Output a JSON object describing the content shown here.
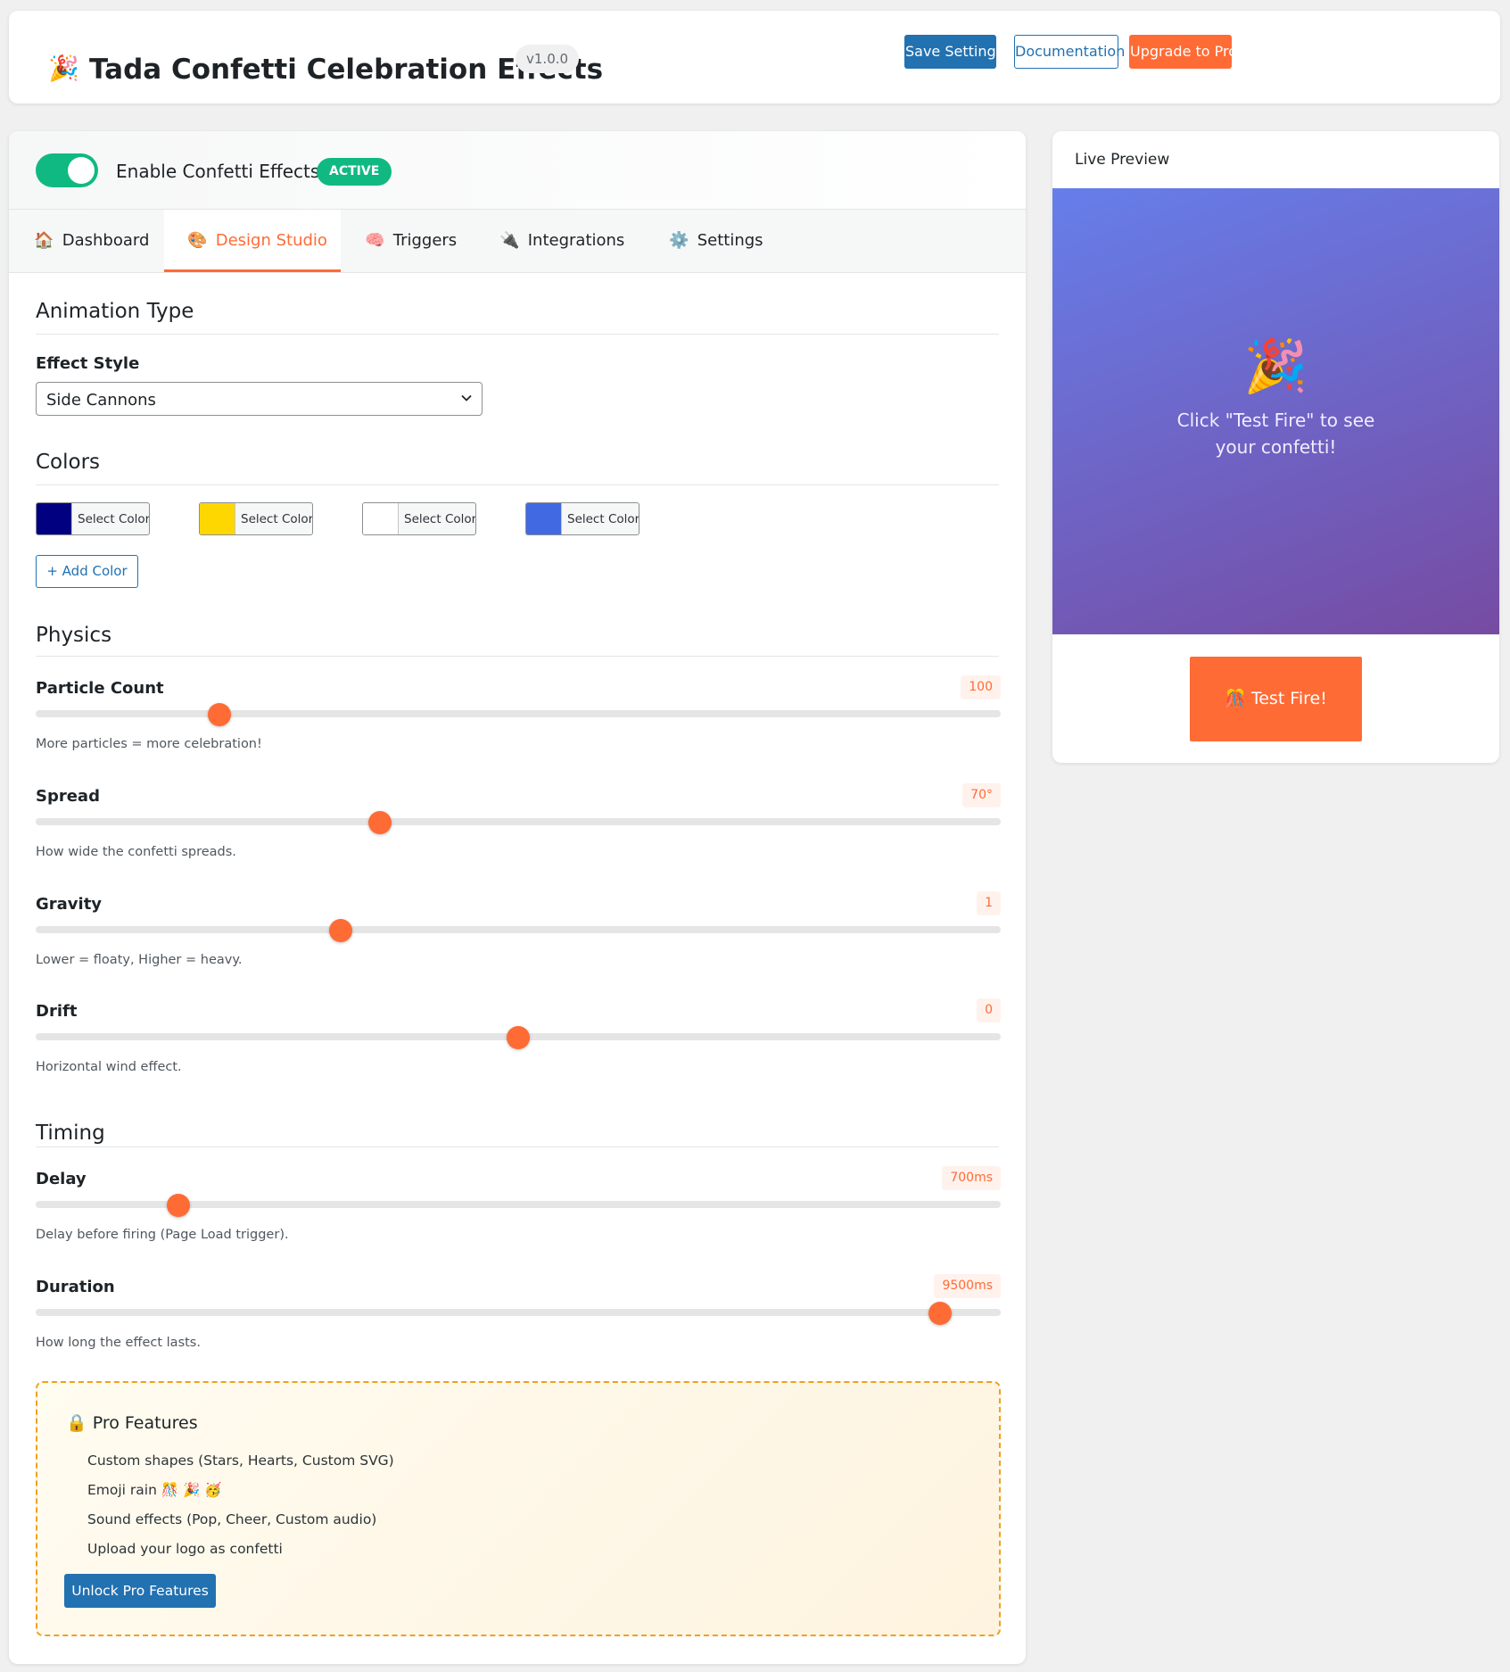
{
  "header": {
    "logo_icon": "party-popper-icon",
    "logo_glyph": "🎉",
    "title": "Tada Confetti Celebration Effects",
    "version": "v1.0.0",
    "save_label": "Save Settings",
    "docs_label": "Documentation",
    "upgrade_label": "Upgrade to Pro"
  },
  "enable": {
    "label": "Enable Confetti Effects",
    "status": "ACTIVE",
    "enabled": true
  },
  "tabs": [
    {
      "icon": "house-icon",
      "glyph": "🏠",
      "label": "Dashboard",
      "active": false
    },
    {
      "icon": "palette-icon",
      "glyph": "🎨",
      "label": "Design Studio",
      "active": true
    },
    {
      "icon": "brain-icon",
      "glyph": "🧠",
      "label": "Triggers",
      "active": false
    },
    {
      "icon": "plug-icon",
      "glyph": "🔌",
      "label": "Integrations",
      "active": false
    },
    {
      "icon": "gear-icon",
      "glyph": "⚙️",
      "label": "Settings",
      "active": false
    }
  ],
  "animation": {
    "section_title": "Animation Type",
    "effect_label": "Effect Style",
    "effect_value": "Side Cannons"
  },
  "colors": {
    "section_title": "Colors",
    "swatches": [
      {
        "color": "#000080",
        "label": "Select Color"
      },
      {
        "color": "#ffd700",
        "label": "Select Color"
      },
      {
        "color": "#ffffff",
        "label": "Select Color"
      },
      {
        "color": "#4169e1",
        "label": "Select Color"
      }
    ],
    "add_label": "+ Add Color"
  },
  "physics": {
    "section_title": "Physics",
    "sliders": [
      {
        "label": "Particle Count",
        "value": "100",
        "position": 0.19,
        "hint": "More particles = more celebration!"
      },
      {
        "label": "Spread",
        "value": "70°",
        "position": 0.357,
        "hint": "How wide the confetti spreads."
      },
      {
        "label": "Gravity",
        "value": "1",
        "position": 0.316,
        "hint": "Lower = floaty, Higher = heavy."
      },
      {
        "label": "Drift",
        "value": "0",
        "position": 0.5,
        "hint": "Horizontal wind effect."
      }
    ]
  },
  "timing": {
    "section_title": "Timing",
    "sliders": [
      {
        "label": "Delay",
        "value": "700ms",
        "position": 0.148,
        "hint": "Delay before firing (Page Load trigger)."
      },
      {
        "label": "Duration",
        "value": "9500ms",
        "position": 0.937,
        "hint": "How long the effect lasts."
      }
    ]
  },
  "pro": {
    "lock_icon": "lock-icon",
    "lock_glyph": "🔒",
    "title": "Pro Features",
    "items": [
      "Custom shapes (Stars, Hearts, Custom SVG)",
      "Emoji rain 🎊 🎉 🥳",
      "Sound effects (Pop, Cheer, Custom audio)",
      "Upload your logo as confetti"
    ],
    "button_label": "Unlock Pro Features"
  },
  "preview": {
    "title": "Live Preview",
    "stage_icon": "party-popper-icon",
    "stage_glyph": "🎉",
    "message": "Click \"Test Fire\" to see your confetti!",
    "button_icon": "confetti-ball-icon",
    "button_label": "🎊 Test Fire!"
  },
  "colors_theme": {
    "accent": "#ff6b35",
    "primary": "#2271b1",
    "active_green": "#10b981",
    "stage_gradient_start": "#667eea",
    "stage_gradient_end": "#764ba2"
  }
}
